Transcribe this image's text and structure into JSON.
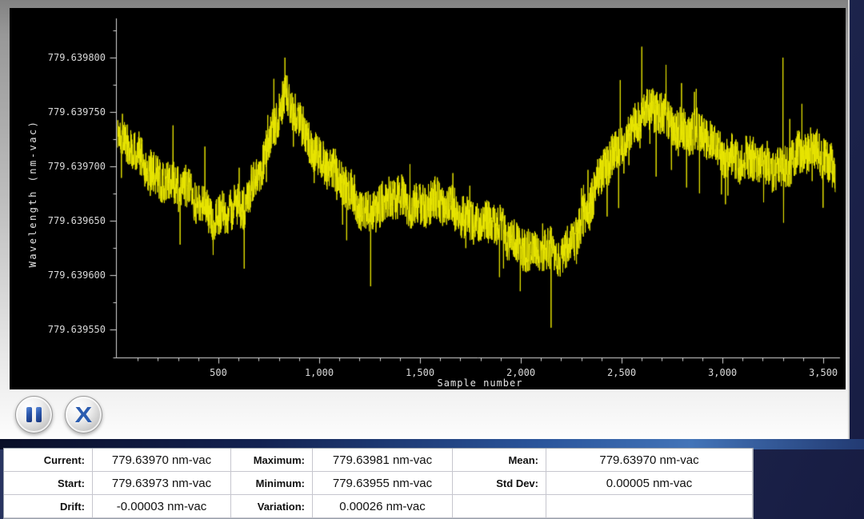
{
  "colors": {
    "trace": "#e9e600",
    "chart_bg": "#000000",
    "axis": "#d8d8d8",
    "accent_blue": "#2b5cb0",
    "panel_navy": "#1c2951"
  },
  "toolbar": {
    "pause_button": "pause",
    "close_label": "X"
  },
  "chart_data": {
    "type": "line",
    "title": "",
    "xlabel": "Sample number",
    "ylabel": "Wavelength (nm-vac)",
    "legend": null,
    "grid": false,
    "xlim": [
      0,
      3575
    ],
    "ylim": [
      779.6395243,
      779.639836
    ],
    "x_ticks": [
      500,
      1000,
      1500,
      2000,
      2500,
      3000,
      3500
    ],
    "x_tick_labels": [
      "500",
      "1,000",
      "1,500",
      "2,000",
      "2,500",
      "3,000",
      "3,500"
    ],
    "x_minor_step": 100,
    "y_ticks": [
      779.63955,
      779.6396,
      779.63965,
      779.6397,
      779.63975,
      779.6398
    ],
    "y_tick_labels": [
      "779.639550",
      "779.639600",
      "779.639650",
      "779.639700",
      "779.639750",
      "779.639800"
    ],
    "y_minor_ticks": [
      779.639525,
      779.639575,
      779.639625,
      779.639675,
      779.639725,
      779.639775,
      779.639825
    ],
    "n_samples": 3560,
    "line_color": "#e9e600",
    "axis_color": "#d8d8d8",
    "bg_color": "#000000",
    "baseline_keypoints": [
      [
        0,
        779.63973
      ],
      [
        120,
        779.639705
      ],
      [
        300,
        779.63968
      ],
      [
        500,
        779.639655
      ],
      [
        620,
        779.63966
      ],
      [
        750,
        779.639725
      ],
      [
        830,
        779.63976
      ],
      [
        900,
        779.639745
      ],
      [
        1000,
        779.63971
      ],
      [
        1100,
        779.639685
      ],
      [
        1250,
        779.63966
      ],
      [
        1400,
        779.63967
      ],
      [
        1600,
        779.639665
      ],
      [
        1800,
        779.63965
      ],
      [
        1950,
        779.639635
      ],
      [
        2100,
        779.63962
      ],
      [
        2200,
        779.639618
      ],
      [
        2320,
        779.639655
      ],
      [
        2450,
        779.63971
      ],
      [
        2560,
        779.63974
      ],
      [
        2680,
        779.63975
      ],
      [
        2800,
        779.639735
      ],
      [
        2950,
        779.639722
      ],
      [
        3100,
        779.639705
      ],
      [
        3250,
        779.639698
      ],
      [
        3400,
        779.63971
      ],
      [
        3480,
        779.639715
      ],
      [
        3560,
        779.6397
      ]
    ],
    "wobble": [
      [
        4e-06,
        41
      ],
      [
        3e-06,
        13
      ]
    ],
    "noise": {
      "seed": 1337,
      "uniform_halfwidth": 2e-05,
      "spike_prob": 0.03,
      "spike_max": 4.5e-05,
      "clamp": [
        779.639552,
        779.63981
      ]
    },
    "feature_spikes": [
      [
        830,
        779.6398
      ],
      [
        1255,
        779.63959
      ],
      [
        2150,
        779.639552
      ],
      [
        2600,
        779.63981
      ],
      [
        3300,
        779.6398
      ]
    ]
  },
  "stats": {
    "col1": [
      {
        "label": "Current:",
        "value": "779.63970 nm-vac"
      },
      {
        "label": "Start:",
        "value": "779.63973 nm-vac"
      },
      {
        "label": "Drift:",
        "value": "-0.00003 nm-vac"
      }
    ],
    "col2": [
      {
        "label": "Maximum:",
        "value": "779.63981 nm-vac"
      },
      {
        "label": "Minimum:",
        "value": "779.63955 nm-vac"
      },
      {
        "label": "Variation:",
        "value": "0.00026 nm-vac"
      }
    ],
    "col3": [
      {
        "label": "Mean:",
        "value": "779.63970 nm-vac"
      },
      {
        "label": "Std Dev:",
        "value": "0.00005 nm-vac"
      },
      {
        "label": "",
        "value": ""
      }
    ]
  }
}
